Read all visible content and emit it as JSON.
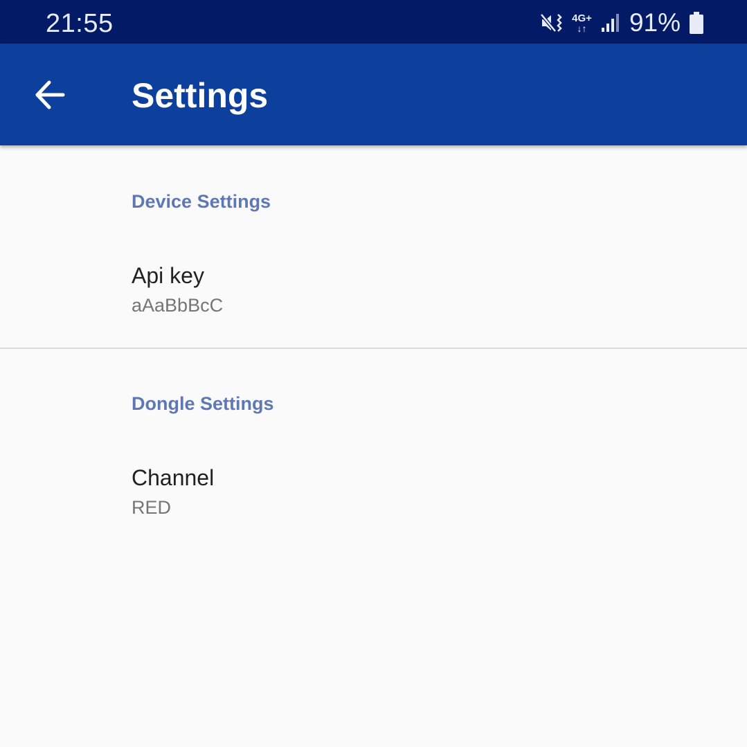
{
  "status_bar": {
    "time": "21:55",
    "network_type": "4G+",
    "network_arrows": "↓↑",
    "battery_percent": "91%",
    "icons": [
      "mute-vibrate-icon",
      "network-data-icon",
      "signal-icon",
      "battery-icon"
    ]
  },
  "app_bar": {
    "title": "Settings",
    "back_icon": "arrow-back-icon",
    "background_color": "#0d3f9c"
  },
  "sections": [
    {
      "header": "Device Settings",
      "items": [
        {
          "title": "Api key",
          "summary": "aAaBbBcC"
        }
      ]
    },
    {
      "header": "Dongle Settings",
      "items": [
        {
          "title": "Channel",
          "summary": "RED"
        }
      ]
    }
  ],
  "colors": {
    "status_bar": "#031a66",
    "accent": "#5f78b5",
    "background": "#fafafa"
  }
}
